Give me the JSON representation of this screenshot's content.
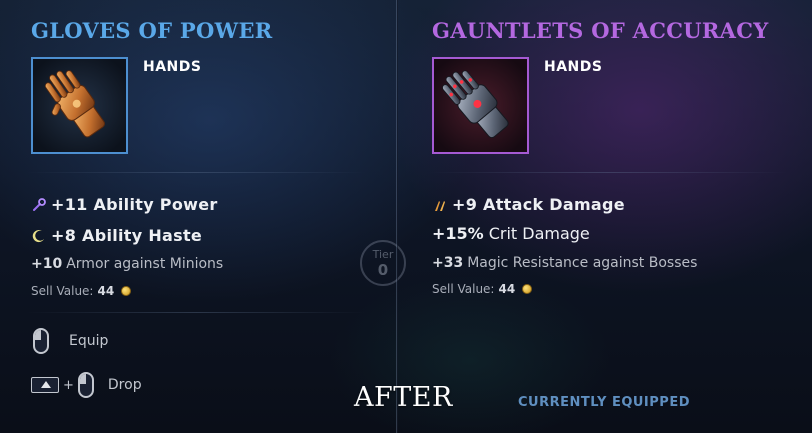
{
  "left_item": {
    "name": "GLOVES OF POWER",
    "slot": "HANDS",
    "icon": "gauntlet-gold-icon",
    "stats": [
      {
        "icon": "ability-power-icon",
        "value": "+11",
        "label": "Ability Power"
      },
      {
        "icon": "ability-haste-icon",
        "value": "+8",
        "label": "Ability Haste"
      }
    ],
    "minor_stat": {
      "value": "+10",
      "label": "Armor against Minions"
    },
    "sell_label": "Sell Value:",
    "sell_value": "44",
    "colors": {
      "title": "#5aa8e8",
      "frame": "#4d8fd0"
    }
  },
  "right_item": {
    "name": "GAUNTLETS OF ACCURACY",
    "slot": "HANDS",
    "icon": "gauntlet-steel-icon",
    "stats": [
      {
        "icon": "attack-damage-icon",
        "value": "+9",
        "label": "Attack Damage"
      }
    ],
    "crit_stat": {
      "value": "+15%",
      "label": "Crit Damage"
    },
    "minor_stat": {
      "value": "+33",
      "label": "Magic Resistance against Bosses"
    },
    "sell_label": "Sell Value:",
    "sell_value": "44",
    "colors": {
      "title": "#b468e0",
      "frame": "#a55ad3"
    }
  },
  "actions": {
    "equip_label": "Equip",
    "drop_label": "Drop",
    "drop_plus": "+"
  },
  "tier_badge": {
    "label": "Tier",
    "value": "0"
  },
  "footer": {
    "after_label": "AFTER",
    "equipped_label": "CURRENTLY EQUIPPED"
  }
}
